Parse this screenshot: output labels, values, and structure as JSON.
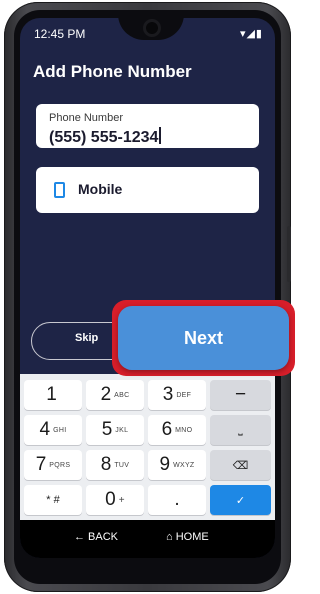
{
  "status": {
    "time": "12:45 PM",
    "icons": "▾◢▮"
  },
  "page": {
    "title": "Add Phone Number"
  },
  "phone_field": {
    "label": "Phone Number",
    "value": "(555) 555-1234"
  },
  "type_field": {
    "value": "Mobile",
    "icon": "mobile-phone-icon"
  },
  "actions": {
    "skip": "Skip",
    "next": "Next"
  },
  "keyboard": {
    "keys": [
      {
        "digit": "1",
        "letters": ""
      },
      {
        "digit": "2",
        "letters": "ABC"
      },
      {
        "digit": "3",
        "letters": "DEF"
      },
      {
        "digit": "4",
        "letters": "GHI"
      },
      {
        "digit": "5",
        "letters": "JKL"
      },
      {
        "digit": "6",
        "letters": "MNO"
      },
      {
        "digit": "7",
        "letters": "PQRS"
      },
      {
        "digit": "8",
        "letters": "TUV"
      },
      {
        "digit": "9",
        "letters": "WXYZ"
      },
      {
        "digit": "0",
        "letters": "+"
      }
    ],
    "minus": "−",
    "space": "⎵",
    "backspace": "⌫",
    "star_hash": "* #",
    "dot": ".",
    "done": "✓"
  },
  "nav": {
    "back": "← BACK",
    "home": "⌂ HOME"
  },
  "colors": {
    "screen_bg": "#1e2446",
    "accent": "#1e88e5",
    "next_button": "#4a90d9",
    "highlight": "#d81e2a"
  }
}
